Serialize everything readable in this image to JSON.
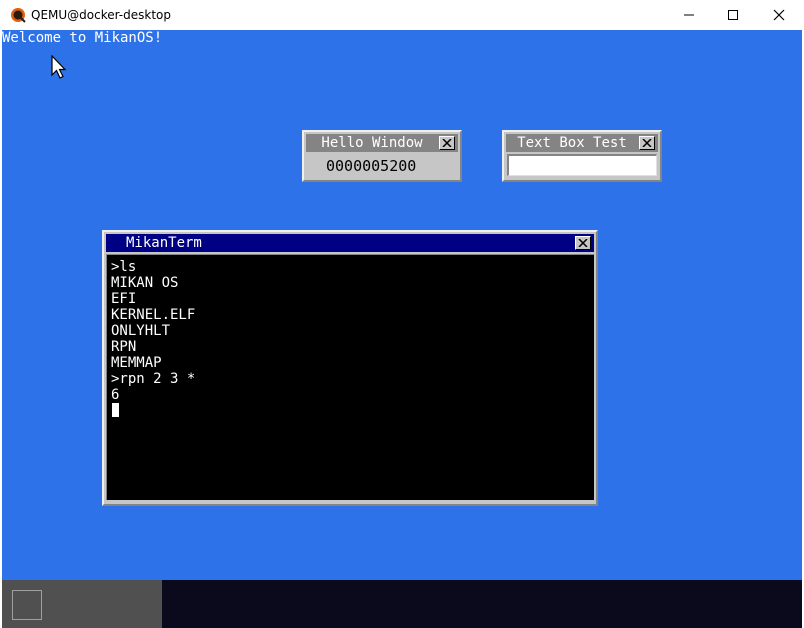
{
  "host_window": {
    "title": "QEMU@docker-desktop",
    "app_icon": "qemu-icon",
    "controls": {
      "minimize_icon": "minimize-icon",
      "maximize_icon": "maximize-icon",
      "close_icon": "close-icon"
    }
  },
  "desktop": {
    "welcome_text": "Welcome to MikanOS!",
    "background_color": "#2d72e8",
    "cursor_icon": "mouse-pointer-icon"
  },
  "windows": {
    "hello": {
      "title": "Hello Window",
      "counter": "0000005200"
    },
    "textbox": {
      "title": "Text Box Test",
      "value": ""
    },
    "terminal": {
      "title": "MikanTerm",
      "lines": [
        ">ls",
        "MIKAN OS",
        "EFI",
        "KERNEL.ELF",
        "ONLYHLT",
        "RPN",
        "MEMMAP",
        ">rpn 2 3 *",
        "6"
      ],
      "title_color": "#000084"
    }
  },
  "taskbar": {
    "start_icon": "start-button-icon"
  }
}
